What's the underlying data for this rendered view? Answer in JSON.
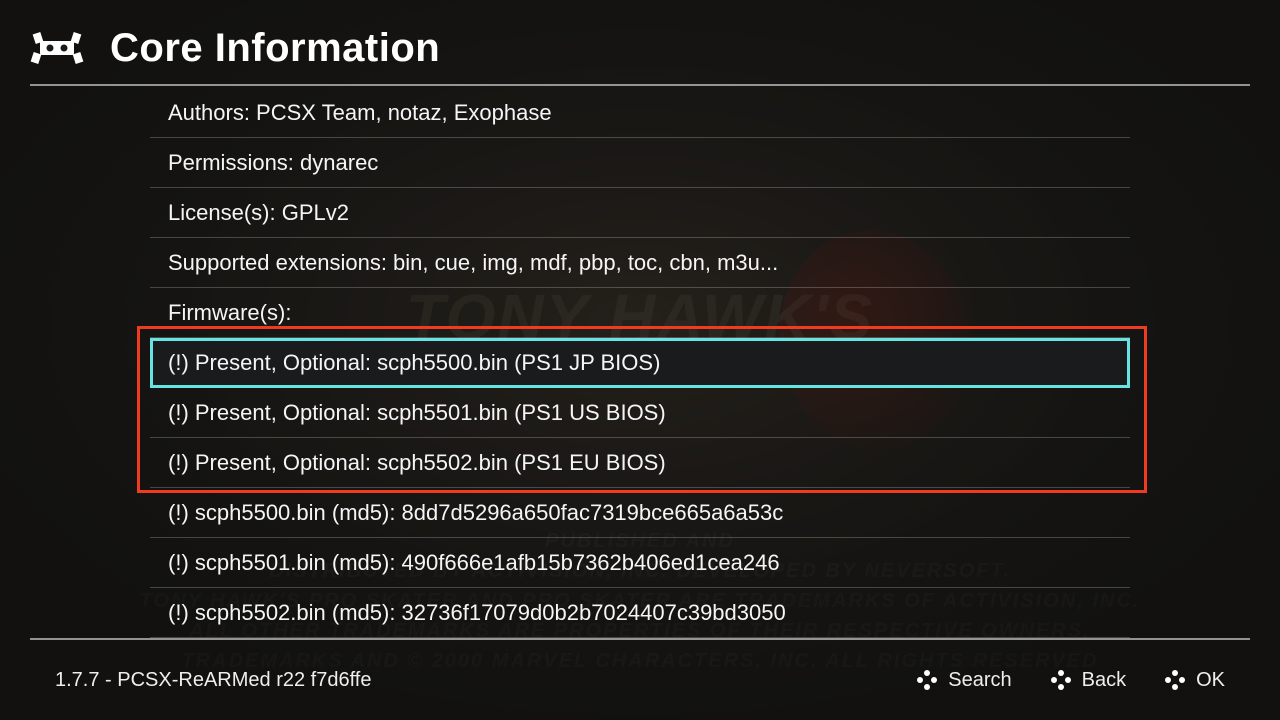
{
  "header": {
    "title": "Core Information"
  },
  "rows": [
    {
      "text": "Authors: PCSX Team, notaz, Exophase"
    },
    {
      "text": "Permissions: dynarec"
    },
    {
      "text": "License(s): GPLv2"
    },
    {
      "text": "Supported extensions: bin, cue, img, mdf, pbp, toc, cbn, m3u..."
    },
    {
      "text": "Firmware(s):"
    },
    {
      "text": "(!) Present, Optional: scph5500.bin (PS1 JP BIOS)",
      "selected": true
    },
    {
      "text": "(!) Present, Optional: scph5501.bin (PS1 US BIOS)"
    },
    {
      "text": "(!) Present, Optional: scph5502.bin (PS1 EU BIOS)"
    },
    {
      "text": "(!) scph5500.bin (md5): 8dd7d5296a650fac7319bce665a6a53c"
    },
    {
      "text": "(!) scph5501.bin (md5): 490f666e1afb15b7362b406ed1cea246"
    },
    {
      "text": "(!) scph5502.bin (md5): 32736f17079d0b2b7024407c39bd3050"
    }
  ],
  "footer": {
    "version": "1.7.7 - PCSX-ReARMed r22 f7d6ffe",
    "actions": {
      "search": "Search",
      "back": "Back",
      "ok": "OK"
    }
  },
  "background": {
    "title": "TONY HAWK'S",
    "lines": [
      "PUBLISHED AND",
      "DISTRIBUTED BY ACTIVISION, INC. DEVELOPED BY NEVERSOFT.",
      "TONY HAWK'S PRO SKATER AND PRO SKATER ARE TRADEMARKS OF ACTIVISION, INC.",
      "ALL OTHER TRADEMARKS ARE PROPERTIES OF THEIR RESPECTIVE OWNERS.",
      "TRADEMARKS AND © 2000 MARVEL CHARACTERS, INC. ALL RIGHTS RESERVED"
    ]
  }
}
